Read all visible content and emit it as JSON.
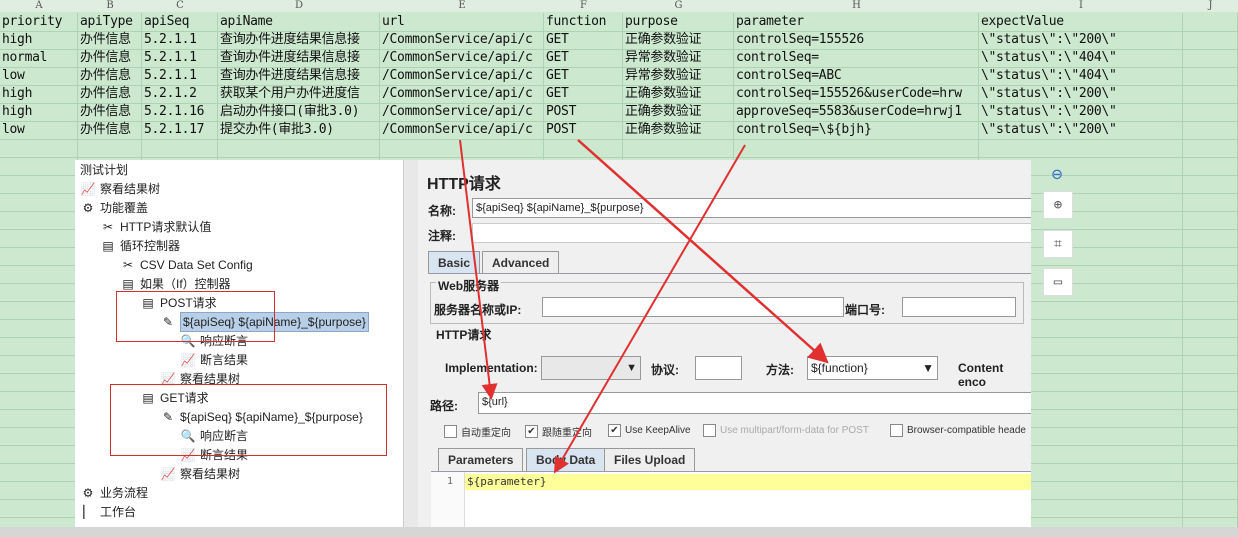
{
  "sheet": {
    "columns": [
      "A",
      "B",
      "C",
      "D",
      "E",
      "F",
      "G",
      "H",
      "I",
      "J"
    ],
    "rows": [
      [
        "priority",
        "apiType",
        "apiSeq",
        "apiName",
        "url",
        "function",
        "purpose",
        "parameter",
        "expectValue"
      ],
      [
        "high",
        "办件信息",
        "5.2.1.1",
        "查询办件进度结果信息接",
        "/CommonService/api/c",
        "GET",
        "正确参数验证",
        "controlSeq=155526",
        "\\\"status\\\":\\\"200\\\""
      ],
      [
        "normal",
        "办件信息",
        "5.2.1.1",
        "查询办件进度结果信息接",
        "/CommonService/api/c",
        "GET",
        "异常参数验证",
        "controlSeq=",
        "\\\"status\\\":\\\"404\\\""
      ],
      [
        "low",
        "办件信息",
        "5.2.1.1",
        "查询办件进度结果信息接",
        "/CommonService/api/c",
        "GET",
        "异常参数验证",
        "controlSeq=ABC",
        "\\\"status\\\":\\\"404\\\""
      ],
      [
        "high",
        "办件信息",
        "5.2.1.2",
        "获取某个用户办件进度信",
        "/CommonService/api/c",
        "GET",
        "正确参数验证",
        "controlSeq=155526&userCode=hrw",
        "\\\"status\\\":\\\"200\\\""
      ],
      [
        "high",
        "办件信息",
        "5.2.1.16",
        "启动办件接口(审批3.0)",
        "/CommonService/api/c",
        "POST",
        "正确参数验证",
        "approveSeq=5583&userCode=hrwj1",
        "\\\"status\\\":\\\"200\\\""
      ],
      [
        "low",
        "办件信息",
        "5.2.1.17",
        "提交办件(审批3.0)",
        "/CommonService/api/c",
        "POST",
        "正确参数验证",
        "controlSeq=\\${bjh}",
        "\\\"status\\\":\\\"200\\\""
      ]
    ]
  },
  "tree": [
    {
      "label": "测试计划",
      "icon": "test-plan-icon"
    },
    {
      "label": "察看结果树",
      "icon": "chart-icon"
    },
    {
      "label": "功能覆盖",
      "icon": "gear-icon"
    },
    {
      "label": "HTTP请求默认值",
      "icon": "tools-icon"
    },
    {
      "label": "循环控制器",
      "icon": "controller-icon"
    },
    {
      "label": "CSV Data Set Config",
      "icon": "tools-icon"
    },
    {
      "label": "如果（If）控制器",
      "icon": "controller-icon"
    },
    {
      "label": "POST请求",
      "icon": "controller-icon"
    },
    {
      "label": "${apiSeq} ${apiName}_${purpose}",
      "icon": "pipette-icon"
    },
    {
      "label": "响应断言",
      "icon": "magnifier-icon"
    },
    {
      "label": "断言结果",
      "icon": "chart-icon"
    },
    {
      "label": "察看结果树",
      "icon": "chart-icon"
    },
    {
      "label": "GET请求",
      "icon": "controller-icon"
    },
    {
      "label": "${apiSeq} ${apiName}_${purpose}",
      "icon": "pipette-icon"
    },
    {
      "label": "响应断言",
      "icon": "magnifier-icon"
    },
    {
      "label": "断言结果",
      "icon": "chart-icon"
    },
    {
      "label": "察看结果树",
      "icon": "chart-icon"
    },
    {
      "label": "业务流程",
      "icon": "gear-icon"
    },
    {
      "label": "工作台",
      "icon": "workbench-icon"
    }
  ],
  "panel": {
    "title": "HTTP请求",
    "name_label": "名称:",
    "name_value": "${apiSeq} ${apiName}_${purpose}",
    "comment_label": "注释:",
    "tabs": [
      "Basic",
      "Advanced"
    ],
    "web_server": "Web服务器",
    "server_label": "服务器名称或IP:",
    "port_label": "端口号:",
    "http_request": "HTTP请求",
    "impl_label": "Implementation:",
    "protocol_label": "协议:",
    "method_label": "方法:",
    "method_value": "${function}",
    "content_label": "Content enco",
    "path_label": "路径:",
    "path_value": "${url}",
    "checkboxes": [
      {
        "label": "自动重定向",
        "checked": false
      },
      {
        "label": "跟随重定向",
        "checked": true
      },
      {
        "label": "Use KeepAlive",
        "checked": true
      },
      {
        "label": "Use multipart/form-data for POST",
        "checked": false
      },
      {
        "label": "Browser-compatible heade",
        "checked": false
      }
    ],
    "body_tabs": [
      "Parameters",
      "Body Data",
      "Files Upload"
    ],
    "line_no": "1",
    "body_value": "${parameter}"
  },
  "colors": {
    "sheet_bg": "#cce8cf",
    "arrow": "#e03030",
    "highlight": "#ffff99"
  }
}
